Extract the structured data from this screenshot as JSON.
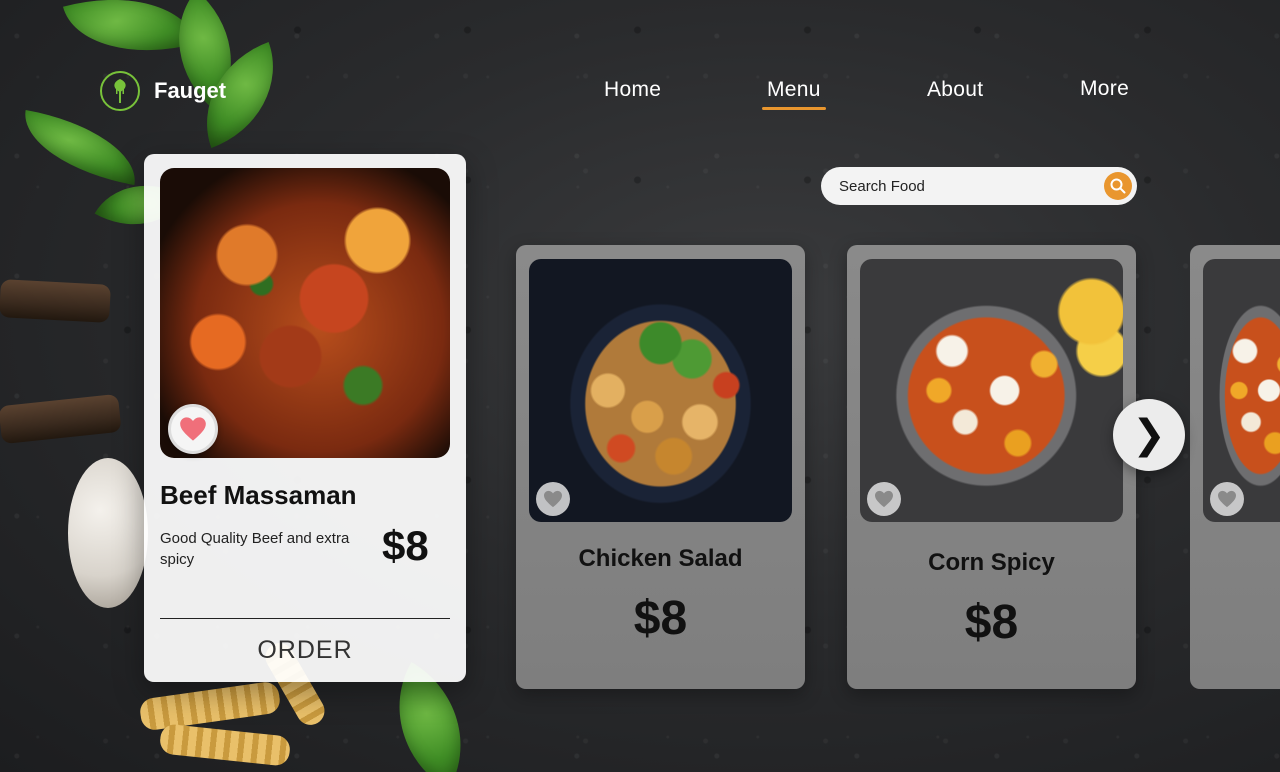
{
  "brand": {
    "name": "Fauget"
  },
  "nav": {
    "items": [
      {
        "label": "Home",
        "active": false
      },
      {
        "label": "Menu",
        "active": true
      },
      {
        "label": "About",
        "active": false
      },
      {
        "label": "More",
        "active": false
      }
    ]
  },
  "search": {
    "placeholder": "Search Food"
  },
  "featured": {
    "title": "Beef Massaman",
    "description": "Good Quality Beef and extra spicy",
    "price": "$8",
    "action_label": "ORDER",
    "favorited": true
  },
  "products": [
    {
      "title": "Chicken Salad",
      "price": "$8",
      "favorited": false
    },
    {
      "title": "Corn Spicy",
      "price": "$8",
      "favorited": false
    }
  ],
  "carousel": {
    "next_icon": "❯"
  },
  "colors": {
    "accent": "#e9962e",
    "logo_green": "#78c23a",
    "heart_pink": "#f06f7a",
    "card_gray": "#848484"
  },
  "icons": {
    "logo": "leaf-fork-icon",
    "search": "search-icon",
    "favorite": "heart-icon",
    "next": "chevron-right-icon"
  }
}
